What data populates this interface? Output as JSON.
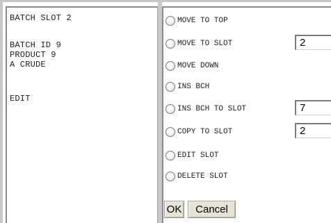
{
  "info": {
    "lines": [
      "BATCH SLOT 2",
      "BATCH ID 9",
      "PRODUCT 9",
      "A CRUDE",
      "EDIT"
    ]
  },
  "options": [
    {
      "label": "MOVE TO TOP",
      "icon": "radio-icon"
    },
    {
      "label": "MOVE TO SLOT",
      "icon": "radio-icon",
      "input_value": "2"
    },
    {
      "label": "MOVE DOWN",
      "icon": "radio-icon"
    },
    {
      "label": "INS BCH",
      "icon": "radio-icon"
    },
    {
      "label": "INS BCH TO SLOT",
      "icon": "radio-icon",
      "input_value": "7"
    },
    {
      "label": "COPY TO SLOT",
      "icon": "radio-icon",
      "input_value": "2"
    },
    {
      "label": "EDIT SLOT",
      "icon": "radio-icon"
    },
    {
      "label": "DELETE SLOT",
      "icon": "radio-icon"
    }
  ],
  "buttons": {
    "ok_label": "OK",
    "cancel_label": "Cancel"
  },
  "colors": {
    "background": "#ffffff",
    "frame": "#c8c8c8",
    "button_face": "#e6e2d6"
  }
}
